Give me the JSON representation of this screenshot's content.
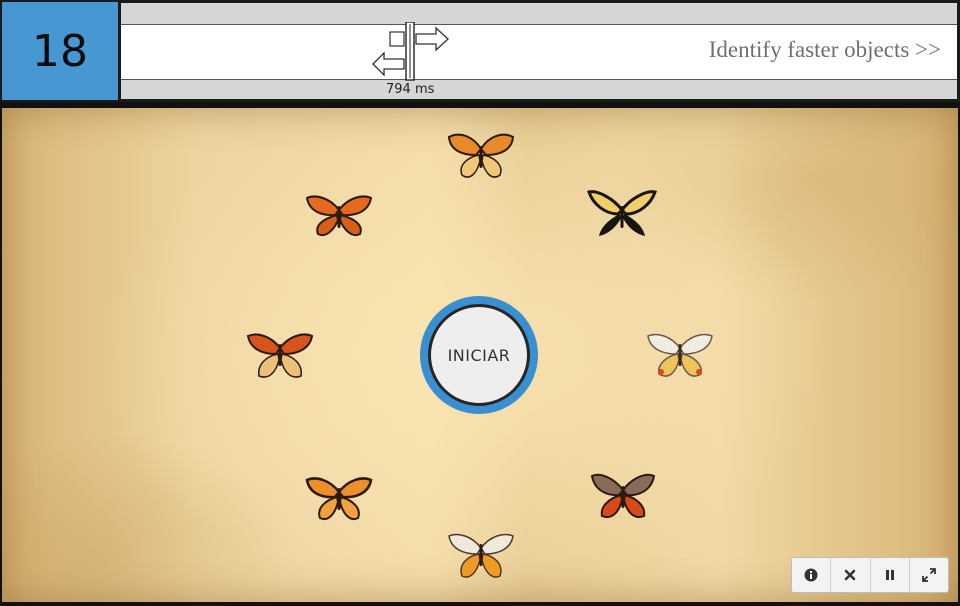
{
  "level": {
    "number": "18"
  },
  "speed": {
    "value_label": "794 ms"
  },
  "hint": {
    "text": "Identify faster objects >>"
  },
  "start_button": {
    "label": "INICIAR"
  },
  "butterflies": [
    {
      "name": "butterfly-top"
    },
    {
      "name": "butterfly-upper-left"
    },
    {
      "name": "butterfly-upper-right"
    },
    {
      "name": "butterfly-left"
    },
    {
      "name": "butterfly-right"
    },
    {
      "name": "butterfly-lower-left"
    },
    {
      "name": "butterfly-lower-right"
    },
    {
      "name": "butterfly-bottom"
    }
  ],
  "toolbar": {
    "icons": [
      "info-icon",
      "close-icon",
      "pause-icon",
      "fullscreen-icon"
    ]
  },
  "colors": {
    "accent_blue": "#4797d2",
    "ring_blue": "#3a8fd0",
    "paper": "#f0d7a4"
  }
}
